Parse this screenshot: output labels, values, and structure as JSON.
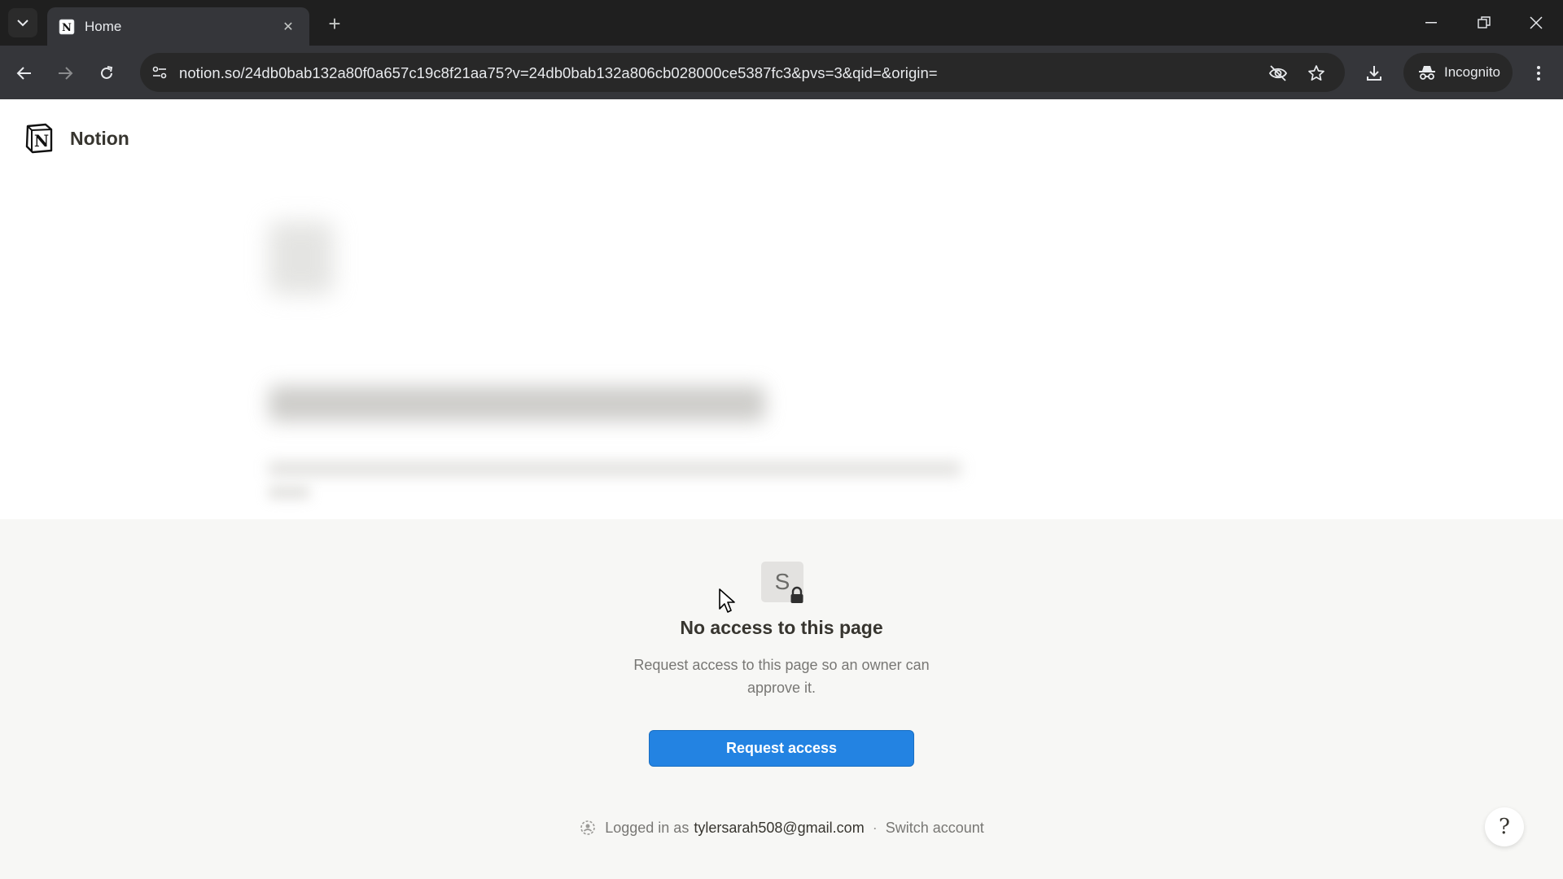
{
  "browser": {
    "tab_title": "Home",
    "url": "notion.so/24db0bab132a80f0a657c19c8f21aa75?v=24db0bab132a806cb028000ce5387fc3&pvs=3&qid=&origin=",
    "incognito_label": "Incognito"
  },
  "page": {
    "brand": "Notion",
    "locked_avatar_letter": "S",
    "heading": "No access to this page",
    "message_line1": "Request access to this page so an owner can",
    "message_line2": "approve it.",
    "request_button": "Request access",
    "logged_in_prefix": "Logged in as",
    "email": "tylersarah508@gmail.com",
    "separator": "·",
    "switch_account": "Switch account",
    "help_glyph": "?"
  },
  "colors": {
    "accent": "#2383e2",
    "text_primary": "#37352f",
    "text_secondary": "#787774",
    "overlay_bg": "#f7f7f5"
  },
  "icons": [
    "tab-search-icon",
    "notion-favicon-icon",
    "close-tab-icon",
    "new-tab-icon",
    "minimize-icon",
    "restore-icon",
    "close-window-icon",
    "back-icon",
    "forward-icon",
    "reload-icon",
    "site-info-icon",
    "eye-off-icon",
    "star-icon",
    "download-icon",
    "incognito-icon",
    "menu-icon",
    "notion-logo-icon",
    "lock-icon",
    "help-icon"
  ]
}
